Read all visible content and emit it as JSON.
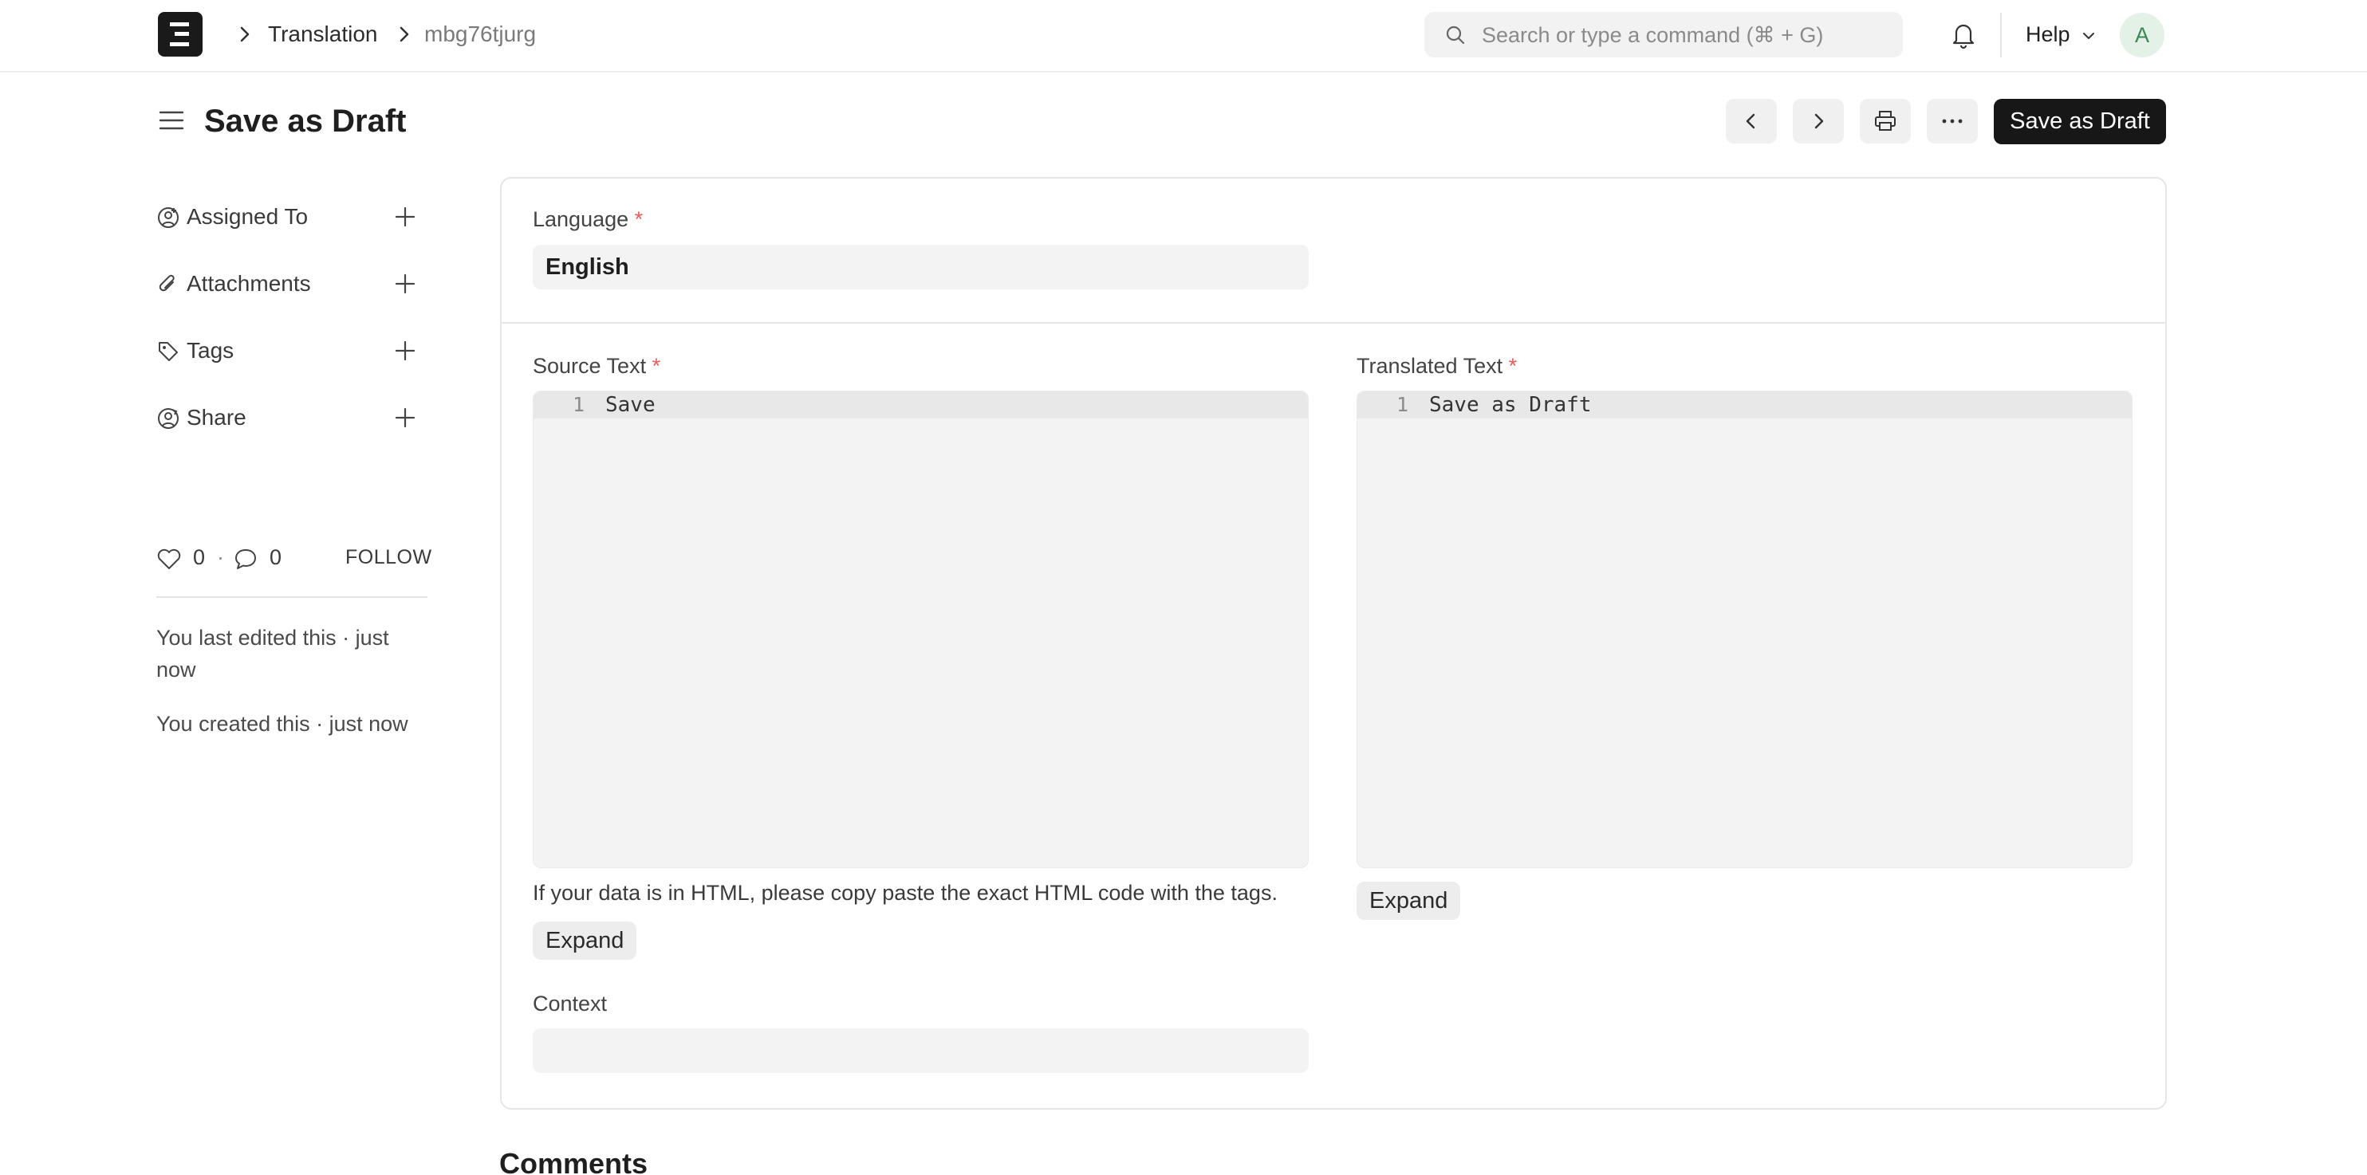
{
  "navbar": {
    "logo_letter": "E",
    "breadcrumbs": [
      "Translation",
      "mbg76tjurg"
    ],
    "search_placeholder": "Search or type a command (⌘ + G)",
    "help_label": "Help",
    "avatar_initial": "A"
  },
  "page": {
    "title": "Save as Draft",
    "primary_action": "Save as Draft"
  },
  "sidebar": {
    "items": [
      {
        "label": "Assigned To",
        "icon": "assign-user-icon"
      },
      {
        "label": "Attachments",
        "icon": "paperclip-icon"
      },
      {
        "label": "Tags",
        "icon": "tag-icon"
      },
      {
        "label": "Share",
        "icon": "share-user-icon"
      }
    ],
    "likes": "0",
    "comments_count": "0",
    "separator": "·",
    "follow_label": "FOLLOW",
    "timeline": [
      "You last edited this · just now",
      "You created this · just now"
    ]
  },
  "form": {
    "language_label": "Language",
    "language_value": "English",
    "source_label": "Source Text",
    "source_line_no": "1",
    "source_value": "Save",
    "source_help": "If your data is in HTML, please copy paste the exact HTML code with the tags.",
    "translated_label": "Translated Text",
    "translated_line_no": "1",
    "translated_value": "Save as Draft",
    "expand_label": "Expand",
    "context_label": "Context",
    "context_value": "",
    "required_mark": "*"
  },
  "comments_heading": "Comments",
  "colors": {
    "primary_button": "#171717",
    "required": "#e45c5c",
    "input_bg": "#f3f3f3",
    "avatar_bg": "#e3f1e7",
    "avatar_fg": "#3b8755"
  }
}
